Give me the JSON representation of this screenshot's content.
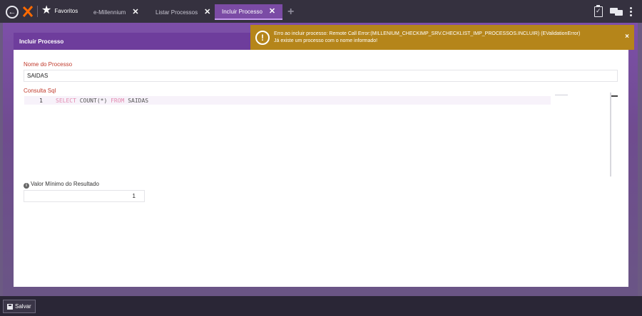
{
  "topbar": {
    "favorites_label": "Favoritos",
    "tabs": [
      {
        "label": "e-Millennium",
        "active": false
      },
      {
        "label": "Listar Processos",
        "active": false
      },
      {
        "label": "Incluir Processo",
        "active": true
      }
    ],
    "close_glyph": "✕",
    "add_tab_glyph": "+"
  },
  "panel": {
    "title": "Incluir Processo",
    "nome_label": "Nome do Processo",
    "nome_value": "SAIDAS",
    "sql_label": "Consulta Sql",
    "sql_line_number": "1",
    "sql_keyword_select": "SELECT",
    "sql_function": "COUNT(*)",
    "sql_keyword_from": "FROM",
    "sql_table": "SAIDAS",
    "valor_label": "Valor Mínimo do Resultado",
    "valor_value": "1"
  },
  "toast": {
    "line1": "Erro ao incluir processo: Remote Call Error:(MILLENIUM_CHECKIMP_SRV.CHECKLIST_IMP_PROCESSOS.INCLUIR) (EValidationError)",
    "line2": "Já existe um processo com o nome informado!",
    "close_glyph": "×",
    "icon": "!"
  },
  "footer": {
    "save_label": "Salvar"
  },
  "colors": {
    "toast_bg": "#b5851a",
    "accent": "#7b4ba5",
    "label_red": "#c0392b"
  }
}
